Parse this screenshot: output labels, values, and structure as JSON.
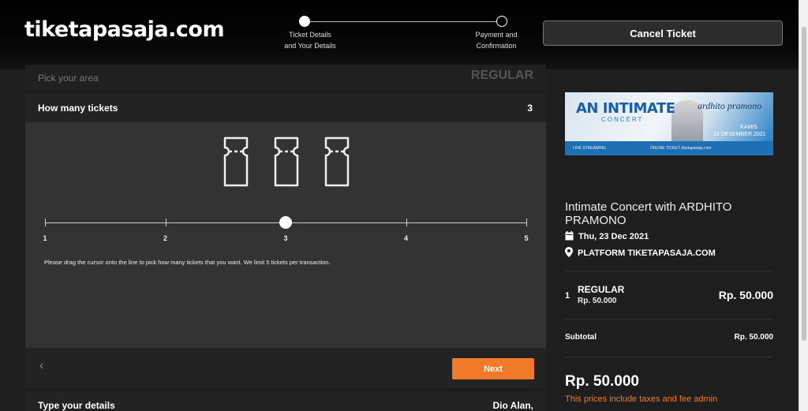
{
  "header": {
    "logo": "tiketapasaja.com",
    "steps": [
      {
        "line1": "Ticket Details",
        "line2": "and Your Details",
        "active": true
      },
      {
        "line1": "Payment and",
        "line2": "Confirmation",
        "active": false
      }
    ],
    "cancel_label": "Cancel Ticket"
  },
  "form": {
    "pick_label": "Pick your area",
    "pick_value": "REGULAR",
    "howmany_label": "How many tickets",
    "howmany_value": "3",
    "ticket_count": 3,
    "slider": {
      "labels": [
        "1",
        "2",
        "3",
        "4",
        "5"
      ],
      "selected": 3
    },
    "hint": "Please drag the cursor onto the line to pick how many tickets that you want. We limit 5 tickets per transaction.",
    "back_glyph": "‹",
    "next_label": "Next",
    "details_label": "Type your details",
    "details_value": "Dio Alan,"
  },
  "event": {
    "banner": {
      "title": "AN INTIMATE",
      "subtitle": "CONCERT",
      "signature": "ardhito pramono",
      "day": "KAMIS",
      "date": "23 DESEMBER 2021",
      "live": "LIVE STREAMING",
      "online": "ONLINE TICKET: tiketapasaja.com"
    },
    "title": "Intimate Concert with ARDHITO PRAMONO",
    "date": "Thu, 23 Dec 2021",
    "venue": "PLATFORM TIKETAPASAJA.COM"
  },
  "summary": {
    "qty": "1",
    "item_name": "REGULAR",
    "item_unit_price": "Rp. 50.000",
    "item_price": "Rp. 50.000",
    "subtotal_label": "Subtotal",
    "subtotal_value": "Rp. 50.000",
    "total": "Rp. 50.000",
    "tax_note": "This prices include taxes and fee admin"
  },
  "colors": {
    "accent": "#f07a28",
    "background": "#1e1e1e",
    "panel": "#333333"
  }
}
